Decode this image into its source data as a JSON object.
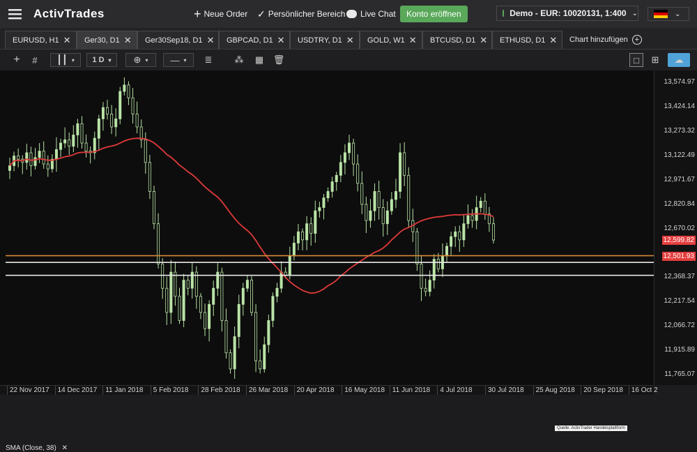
{
  "header": {
    "logo": "ActivTrades",
    "new_order": "Neue Order",
    "personal_area": "Persönlicher Bereich",
    "live_chat": "Live Chat",
    "open_account": "Konto eröffnen",
    "account": "Demo - EUR: 10020131, 1:400"
  },
  "tabs": [
    {
      "label": "EURUSD, H1"
    },
    {
      "label": "Ger30, D1",
      "active": true
    },
    {
      "label": "Ger30Sep18, D1"
    },
    {
      "label": "GBPCAD, D1"
    },
    {
      "label": "USDTRY, D1"
    },
    {
      "label": "GOLD, W1"
    },
    {
      "label": "BTCUSD, D1"
    },
    {
      "label": "ETHUSD, D1"
    }
  ],
  "add_chart": "Chart hinzufügen",
  "toolbar": {
    "timeframe": "1 D"
  },
  "indicator": {
    "label": "SMA  (Close, 38)"
  },
  "source_note": "Quelle: ActivTrader Handelsplattform",
  "colors": {
    "sma": "#e03a3a",
    "candle": "#b9e3a6",
    "orange_line": "#d68a3a",
    "white_line": "#e8e8e8",
    "price_tag": "#e53e3e",
    "button": "#5aa85a"
  },
  "chart_data": {
    "type": "candlestick",
    "price_ticks": [
      "13,574.97",
      "13,424.14",
      "13,273.32",
      "13,122.49",
      "12,971.67",
      "12,820.84",
      "12,670.02",
      "12,368.37",
      "12,217.54",
      "12,066.72",
      "11,915.89",
      "11,765.07"
    ],
    "date_ticks": [
      "22 Nov 2017",
      "14 Dec 2017",
      "11 Jan 2018",
      "5 Feb 2018",
      "28 Feb 2018",
      "26 Mar 2018",
      "20 Apr 2018",
      "16 May 2018",
      "11 Jun 2018",
      "4 Jul 2018",
      "30 Jul 2018",
      "25 Aug 2018",
      "20 Sep 2018",
      "16 Oct 2"
    ],
    "last_price": "12,599.82",
    "line_price": "12,501.93",
    "horizontal_levels": [
      {
        "price": 12501.93,
        "color": "#d68a3a"
      },
      {
        "price": 12460,
        "color": "#e8e8e8"
      },
      {
        "price": 12380,
        "color": "#e8e8e8"
      }
    ],
    "close_series": [
      13060,
      13120,
      13100,
      13080,
      13140,
      13060,
      13110,
      13150,
      13070,
      13040,
      13100,
      13160,
      13200,
      13220,
      13180,
      13250,
      13320,
      13200,
      13150,
      13140,
      13230,
      13350,
      13420,
      13380,
      13300,
      13350,
      13520,
      13560,
      13480,
      13380,
      13300,
      13220,
      13080,
      12900,
      12700,
      12450,
      12300,
      12150,
      12400,
      12250,
      12100,
      12350,
      12300,
      12400,
      12250,
      12150,
      12050,
      12200,
      12300,
      12400,
      12100,
      11900,
      11800,
      12000,
      12200,
      12300,
      12350,
      12150,
      11850,
      11800,
      11950,
      12100,
      12250,
      12300,
      12400,
      12380,
      12500,
      12580,
      12650,
      12600,
      12700,
      12640,
      12780,
      12800,
      12860,
      12900,
      12960,
      13000,
      13080,
      13140,
      13200,
      13070,
      12950,
      12820,
      12720,
      12780,
      12900,
      12800,
      12700,
      12780,
      12850,
      12900,
      13140,
      13000,
      12720,
      12650,
      12450,
      12300,
      12280,
      12350,
      12480,
      12420,
      12500,
      12560,
      12620,
      12650,
      12600,
      12700,
      12750,
      12720,
      12800,
      12840,
      12760,
      12700,
      12599
    ]
  }
}
